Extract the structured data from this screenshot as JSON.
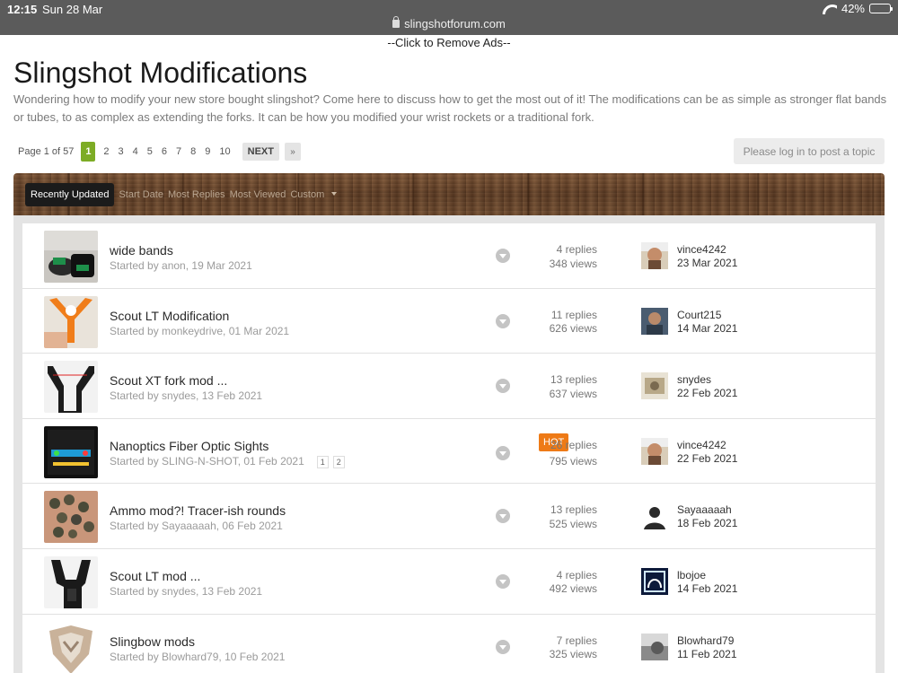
{
  "status_bar": {
    "time": "12:15",
    "date": "Sun 28 Mar",
    "url": "slingshotforum.com",
    "battery": "42%",
    "battery_level": 0.42,
    "icons": [
      "lock-icon",
      "wifi-icon",
      "battery-icon"
    ]
  },
  "ad_notice": "--Click to Remove Ads--",
  "forum": {
    "title": "Slingshot Modifications",
    "description": "Wondering how to modify your new store bought slingshot? Come here to discuss how to get the most out of it! The modifications can be as simple as stronger flat bands or tubes, to as complex as extending the forks. It can be how you modified your wrist rockets or a traditional fork."
  },
  "pagination": {
    "info": "Page 1 of 57",
    "current": "1",
    "pages": [
      "2",
      "3",
      "4",
      "5",
      "6",
      "7",
      "8",
      "9",
      "10"
    ],
    "next": "NEXT",
    "last": "»"
  },
  "login_button": "Please log in to post a topic",
  "sort_tabs": {
    "active": "Recently Updated",
    "others": [
      "Start Date",
      "Most Replies",
      "Most Viewed",
      "Custom"
    ]
  },
  "colors": {
    "accent_green": "#7dac25",
    "hot_orange": "#ee7a16"
  },
  "topics": [
    {
      "title": "wide bands",
      "starter": "Started by anon, 19 Mar 2021",
      "replies": "4 replies",
      "views": "348 views",
      "last_user": "vince4242",
      "last_date": "23 Mar 2021",
      "hot": ""
    },
    {
      "title": "Scout LT Modification",
      "starter": "Started by monkeydrive, 01 Mar 2021",
      "replies": "11 replies",
      "views": "626 views",
      "last_user": "Court215",
      "last_date": "14 Mar 2021",
      "hot": ""
    },
    {
      "title": "Scout XT fork mod ...",
      "starter": "Started by snydes, 13 Feb 2021",
      "replies": "13 replies",
      "views": "637 views",
      "last_user": "snydes",
      "last_date": "22 Feb 2021",
      "hot": ""
    },
    {
      "title": "Nanoptics Fiber Optic Sights",
      "starter": "Started by SLING-N-SHOT, 01 Feb 2021",
      "replies": "26 replies",
      "views": "795 views",
      "last_user": "vince4242",
      "last_date": "22 Feb 2021",
      "hot": "HOT",
      "mini_pages": [
        "1",
        "2"
      ]
    },
    {
      "title": "Ammo mod?! Tracer-ish rounds",
      "starter": "Started by Sayaaaaah, 06 Feb 2021",
      "replies": "13 replies",
      "views": "525 views",
      "last_user": "Sayaaaaah",
      "last_date": "18 Feb 2021",
      "hot": ""
    },
    {
      "title": "Scout LT mod ...",
      "starter": "Started by snydes, 13 Feb 2021",
      "replies": "4 replies",
      "views": "492 views",
      "last_user": "lbojoe",
      "last_date": "14 Feb 2021",
      "hot": ""
    },
    {
      "title": "Slingbow mods",
      "starter": "Started by Blowhard79, 10 Feb 2021",
      "replies": "7 replies",
      "views": "325 views",
      "last_user": "Blowhard79",
      "last_date": "11 Feb 2021",
      "hot": ""
    }
  ]
}
